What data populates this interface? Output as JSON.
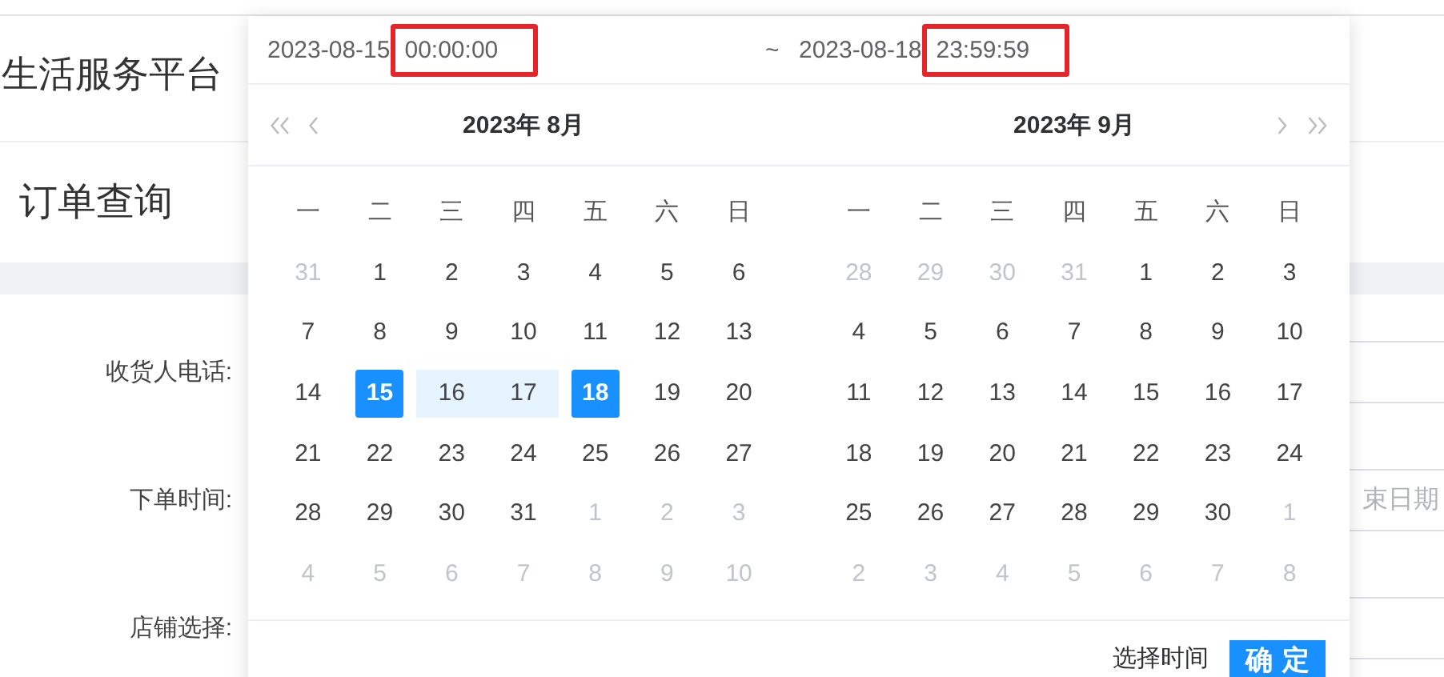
{
  "page": {
    "title": "生活服务平台",
    "heading": "订单查询",
    "form": [
      {
        "label": "收货人电话:"
      },
      {
        "label": "下单时间:",
        "placeholder": "束日期"
      },
      {
        "label": "店铺选择:"
      }
    ]
  },
  "picker": {
    "start": {
      "date": "2023-08-15",
      "time": "00:00:00",
      "highlighted": true
    },
    "separator": "~",
    "end": {
      "date": "2023-08-18",
      "time": "23:59:59",
      "highlighted": true
    },
    "months": [
      {
        "title": "2023年 8月",
        "weekdays": [
          "一",
          "二",
          "三",
          "四",
          "五",
          "六",
          "日"
        ],
        "weeks": [
          [
            {
              "day": "31",
              "kind": "other",
              "selected": false,
              "in_range": false
            },
            {
              "day": "1",
              "kind": "current",
              "selected": false,
              "in_range": false
            },
            {
              "day": "2",
              "kind": "current",
              "selected": false,
              "in_range": false
            },
            {
              "day": "3",
              "kind": "current",
              "selected": false,
              "in_range": false
            },
            {
              "day": "4",
              "kind": "current",
              "selected": false,
              "in_range": false
            },
            {
              "day": "5",
              "kind": "current",
              "selected": false,
              "in_range": false
            },
            {
              "day": "6",
              "kind": "current",
              "selected": false,
              "in_range": false
            }
          ],
          [
            {
              "day": "7",
              "kind": "current",
              "selected": false,
              "in_range": false
            },
            {
              "day": "8",
              "kind": "current",
              "selected": false,
              "in_range": false
            },
            {
              "day": "9",
              "kind": "current",
              "selected": false,
              "in_range": false
            },
            {
              "day": "10",
              "kind": "current",
              "selected": false,
              "in_range": false
            },
            {
              "day": "11",
              "kind": "current",
              "selected": false,
              "in_range": false
            },
            {
              "day": "12",
              "kind": "current",
              "selected": false,
              "in_range": false
            },
            {
              "day": "13",
              "kind": "current",
              "selected": false,
              "in_range": false
            }
          ],
          [
            {
              "day": "14",
              "kind": "current",
              "selected": false,
              "in_range": false
            },
            {
              "day": "15",
              "kind": "current",
              "selected": true,
              "in_range": false
            },
            {
              "day": "16",
              "kind": "current",
              "selected": false,
              "in_range": true
            },
            {
              "day": "17",
              "kind": "current",
              "selected": false,
              "in_range": true
            },
            {
              "day": "18",
              "kind": "current",
              "selected": true,
              "in_range": false
            },
            {
              "day": "19",
              "kind": "current",
              "selected": false,
              "in_range": false
            },
            {
              "day": "20",
              "kind": "current",
              "selected": false,
              "in_range": false
            }
          ],
          [
            {
              "day": "21",
              "kind": "current",
              "selected": false,
              "in_range": false
            },
            {
              "day": "22",
              "kind": "current",
              "selected": false,
              "in_range": false
            },
            {
              "day": "23",
              "kind": "current",
              "selected": false,
              "in_range": false
            },
            {
              "day": "24",
              "kind": "current",
              "selected": false,
              "in_range": false
            },
            {
              "day": "25",
              "kind": "current",
              "selected": false,
              "in_range": false
            },
            {
              "day": "26",
              "kind": "current",
              "selected": false,
              "in_range": false
            },
            {
              "day": "27",
              "kind": "current",
              "selected": false,
              "in_range": false
            }
          ],
          [
            {
              "day": "28",
              "kind": "current",
              "selected": false,
              "in_range": false
            },
            {
              "day": "29",
              "kind": "current",
              "selected": false,
              "in_range": false
            },
            {
              "day": "30",
              "kind": "current",
              "selected": false,
              "in_range": false
            },
            {
              "day": "31",
              "kind": "current",
              "selected": false,
              "in_range": false
            },
            {
              "day": "1",
              "kind": "other",
              "selected": false,
              "in_range": false
            },
            {
              "day": "2",
              "kind": "other",
              "selected": false,
              "in_range": false
            },
            {
              "day": "3",
              "kind": "other",
              "selected": false,
              "in_range": false
            }
          ],
          [
            {
              "day": "4",
              "kind": "other",
              "selected": false,
              "in_range": false
            },
            {
              "day": "5",
              "kind": "other",
              "selected": false,
              "in_range": false
            },
            {
              "day": "6",
              "kind": "other",
              "selected": false,
              "in_range": false
            },
            {
              "day": "7",
              "kind": "other",
              "selected": false,
              "in_range": false
            },
            {
              "day": "8",
              "kind": "other",
              "selected": false,
              "in_range": false
            },
            {
              "day": "9",
              "kind": "other",
              "selected": false,
              "in_range": false
            },
            {
              "day": "10",
              "kind": "other",
              "selected": false,
              "in_range": false
            }
          ]
        ]
      },
      {
        "title": "2023年 9月",
        "weekdays": [
          "一",
          "二",
          "三",
          "四",
          "五",
          "六",
          "日"
        ],
        "weeks": [
          [
            {
              "day": "28",
              "kind": "other",
              "selected": false,
              "in_range": false
            },
            {
              "day": "29",
              "kind": "other",
              "selected": false,
              "in_range": false
            },
            {
              "day": "30",
              "kind": "other",
              "selected": false,
              "in_range": false
            },
            {
              "day": "31",
              "kind": "other",
              "selected": false,
              "in_range": false
            },
            {
              "day": "1",
              "kind": "current",
              "selected": false,
              "in_range": false
            },
            {
              "day": "2",
              "kind": "current",
              "selected": false,
              "in_range": false
            },
            {
              "day": "3",
              "kind": "current",
              "selected": false,
              "in_range": false
            }
          ],
          [
            {
              "day": "4",
              "kind": "current",
              "selected": false,
              "in_range": false
            },
            {
              "day": "5",
              "kind": "current",
              "selected": false,
              "in_range": false
            },
            {
              "day": "6",
              "kind": "current",
              "selected": false,
              "in_range": false
            },
            {
              "day": "7",
              "kind": "current",
              "selected": false,
              "in_range": false
            },
            {
              "day": "8",
              "kind": "current",
              "selected": false,
              "in_range": false
            },
            {
              "day": "9",
              "kind": "current",
              "selected": false,
              "in_range": false
            },
            {
              "day": "10",
              "kind": "current",
              "selected": false,
              "in_range": false
            }
          ],
          [
            {
              "day": "11",
              "kind": "current",
              "selected": false,
              "in_range": false
            },
            {
              "day": "12",
              "kind": "current",
              "selected": false,
              "in_range": false
            },
            {
              "day": "13",
              "kind": "current",
              "selected": false,
              "in_range": false
            },
            {
              "day": "14",
              "kind": "current",
              "selected": false,
              "in_range": false
            },
            {
              "day": "15",
              "kind": "current",
              "selected": false,
              "in_range": false
            },
            {
              "day": "16",
              "kind": "current",
              "selected": false,
              "in_range": false
            },
            {
              "day": "17",
              "kind": "current",
              "selected": false,
              "in_range": false
            }
          ],
          [
            {
              "day": "18",
              "kind": "current",
              "selected": false,
              "in_range": false
            },
            {
              "day": "19",
              "kind": "current",
              "selected": false,
              "in_range": false
            },
            {
              "day": "20",
              "kind": "current",
              "selected": false,
              "in_range": false
            },
            {
              "day": "21",
              "kind": "current",
              "selected": false,
              "in_range": false
            },
            {
              "day": "22",
              "kind": "current",
              "selected": false,
              "in_range": false
            },
            {
              "day": "23",
              "kind": "current",
              "selected": false,
              "in_range": false
            },
            {
              "day": "24",
              "kind": "current",
              "selected": false,
              "in_range": false
            }
          ],
          [
            {
              "day": "25",
              "kind": "current",
              "selected": false,
              "in_range": false
            },
            {
              "day": "26",
              "kind": "current",
              "selected": false,
              "in_range": false
            },
            {
              "day": "27",
              "kind": "current",
              "selected": false,
              "in_range": false
            },
            {
              "day": "28",
              "kind": "current",
              "selected": false,
              "in_range": false
            },
            {
              "day": "29",
              "kind": "current",
              "selected": false,
              "in_range": false
            },
            {
              "day": "30",
              "kind": "current",
              "selected": false,
              "in_range": false
            },
            {
              "day": "1",
              "kind": "other",
              "selected": false,
              "in_range": false
            }
          ],
          [
            {
              "day": "2",
              "kind": "other",
              "selected": false,
              "in_range": false
            },
            {
              "day": "3",
              "kind": "other",
              "selected": false,
              "in_range": false
            },
            {
              "day": "4",
              "kind": "other",
              "selected": false,
              "in_range": false
            },
            {
              "day": "5",
              "kind": "other",
              "selected": false,
              "in_range": false
            },
            {
              "day": "6",
              "kind": "other",
              "selected": false,
              "in_range": false
            },
            {
              "day": "7",
              "kind": "other",
              "selected": false,
              "in_range": false
            },
            {
              "day": "8",
              "kind": "other",
              "selected": false,
              "in_range": false
            }
          ]
        ]
      }
    ],
    "footer": {
      "time_link": "选择时间",
      "confirm": "确定"
    }
  }
}
